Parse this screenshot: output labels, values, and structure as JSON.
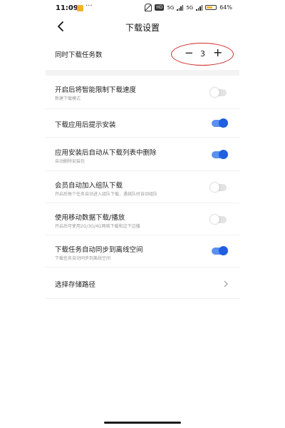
{
  "status_bar": {
    "time": "11:09",
    "overflow_dots": "···",
    "hd_badge": "HD",
    "signal_1": "5G",
    "signal_2": "5G",
    "battery_text": "64%",
    "battery_level": 0.64
  },
  "header": {
    "title": "下载设置"
  },
  "concurrent": {
    "label": "同时下载任务数",
    "value": "3",
    "minus": "−",
    "plus": "+"
  },
  "settings": [
    {
      "title": "开启后将智能限制下载速度",
      "subtitle": "新建下载模式",
      "state": "off"
    },
    {
      "title": "下载应用后提示安装",
      "subtitle": "",
      "state": "on"
    },
    {
      "title": "应用安装后自动从下载列表中删除",
      "subtitle": "自动删除安装包",
      "state": "on"
    },
    {
      "title": "会员自动加入组队下载",
      "subtitle": "开启后每个任务自动进入组队下载，遇挑队时自动组队",
      "state": "off"
    },
    {
      "title": "使用移动数据下载/播放",
      "subtitle": "开启后可使用2G/3G/4G网络下载和边下边播",
      "state": "off"
    },
    {
      "title": "下载任务自动同步到离线空间",
      "subtitle": "下载任务自动同步到离线空间",
      "state": "on"
    }
  ],
  "storage": {
    "label": "选择存储路径"
  },
  "colors": {
    "accent": "#1f5fe0",
    "annotation": "#d12b2b"
  }
}
